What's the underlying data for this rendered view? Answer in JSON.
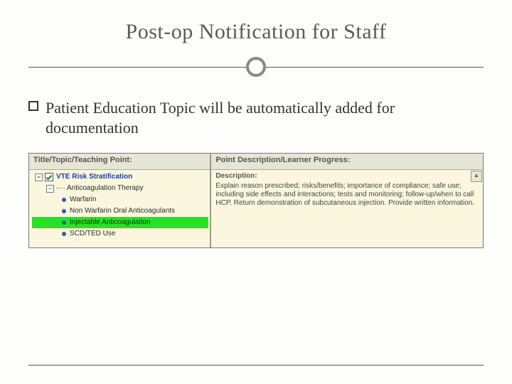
{
  "title": "Post-op Notification for Staff",
  "bullet_text": "Patient Education Topic will be automatically added for documentation",
  "left_header": "Title/Topic/Teaching Point:",
  "right_header": "Point Description/Learner Progress:",
  "tree": {
    "root": "VTE Risk Stratification",
    "sub": "Anticoagulation Therapy",
    "items": [
      "Warfarin",
      "Non Warfarin Oral Anticoagulants",
      "Injectable Anticoagulation",
      "SCD/TED Use"
    ]
  },
  "desc_label": "Description:",
  "desc_text": "Explain reason prescribed; risks/benefits; importance of compliance; safe use; including side effects and interactions; tests and monitoring; follow-up/when to call HCP. Return demonstration of subcutaneous injection. Provide written information."
}
